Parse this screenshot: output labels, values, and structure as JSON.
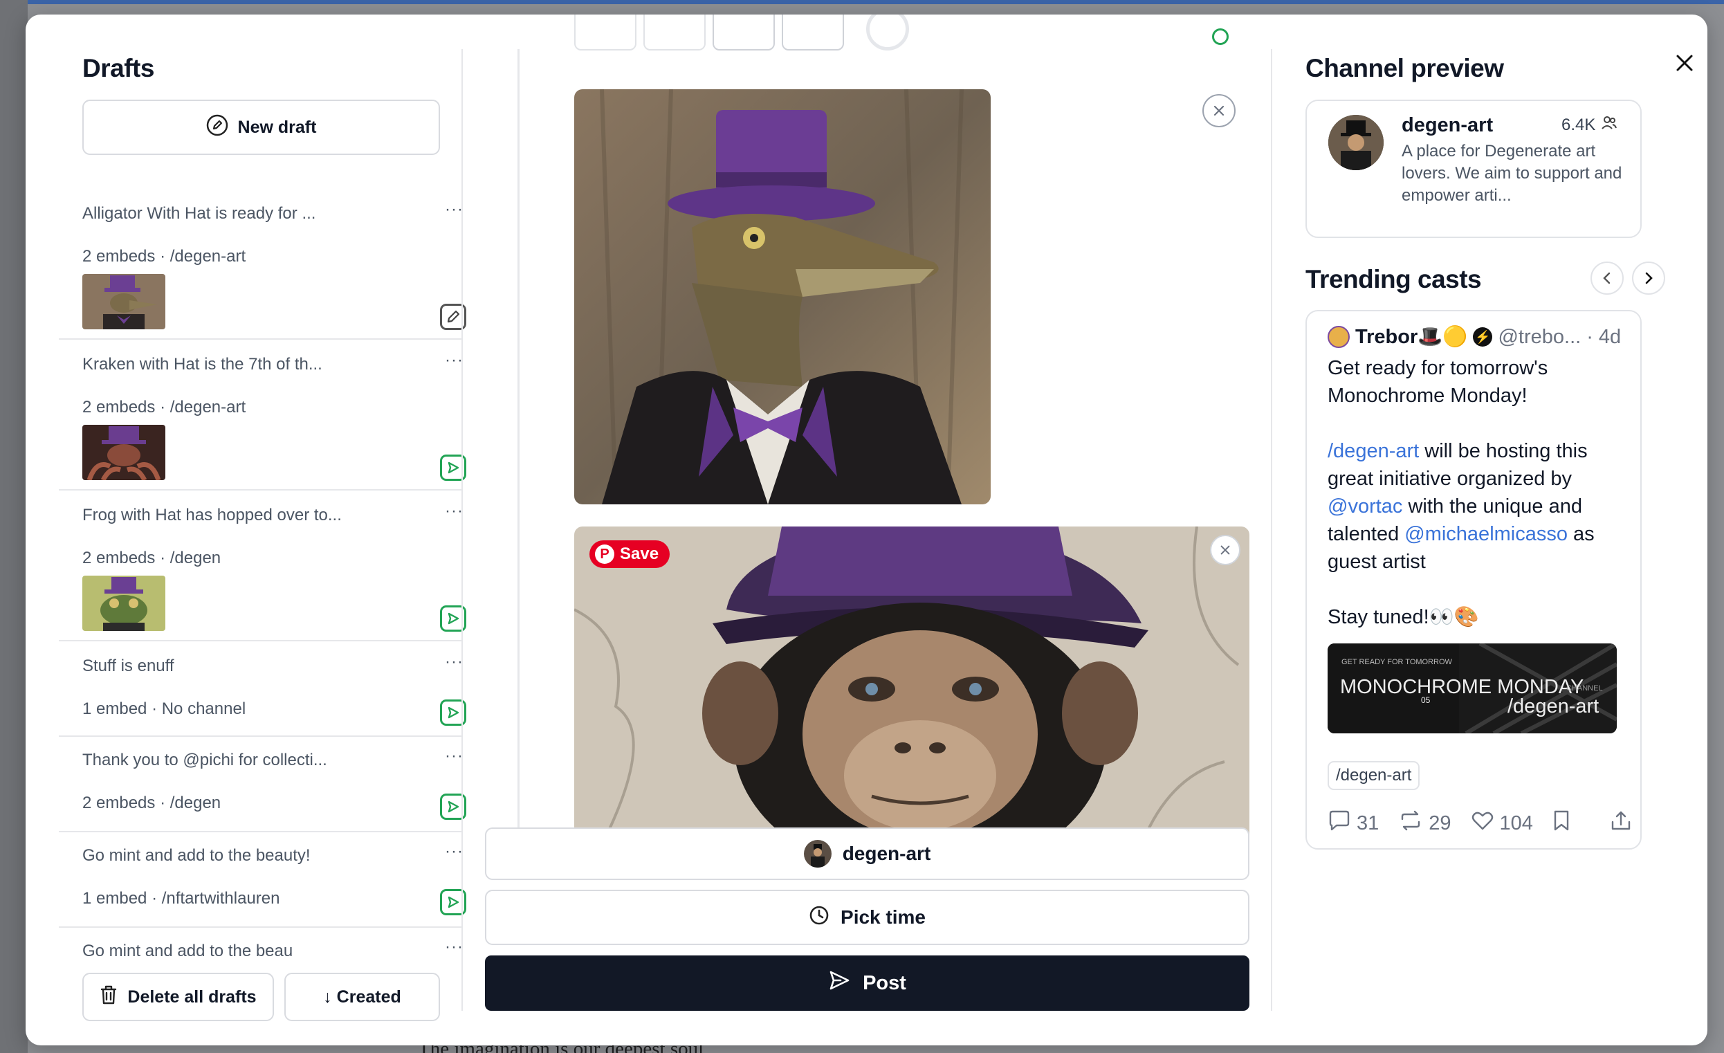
{
  "background": {
    "footer_text": "The imagination is our deepest soul"
  },
  "drafts": {
    "title": "Drafts",
    "new_draft_label": "New draft",
    "items": [
      {
        "title": "Alligator With Hat is ready for ...",
        "meta": "2 embeds · /degen-art",
        "thumb": "alligator",
        "action": "edit"
      },
      {
        "title": "Kraken with Hat is the 7th of th...",
        "meta": "2 embeds · /degen-art",
        "thumb": "kraken",
        "action": "send"
      },
      {
        "title": "Frog with Hat has hopped over to...",
        "meta": "2 embeds · /degen",
        "thumb": "frog",
        "action": "send"
      },
      {
        "title": "Stuff is enuff",
        "meta": "1 embed · No channel",
        "thumb": "",
        "action": "send"
      },
      {
        "title": "Thank you to @pichi for collecti...",
        "meta": "2 embeds · /degen",
        "thumb": "",
        "action": "send"
      },
      {
        "title": "Go mint and add to the beauty!",
        "meta": "1 embed · /nftartwithlauren",
        "thumb": "",
        "action": "send"
      },
      {
        "title": "Go mint and add to the beau",
        "meta": "",
        "thumb": "",
        "action": ""
      }
    ],
    "more_label": "···",
    "delete_all_label": "Delete all drafts",
    "sort_label": "↓ Created"
  },
  "composer": {
    "pin_save_label": "Save",
    "channel_label": "degen-art",
    "pick_time_label": "Pick time",
    "post_label": "Post"
  },
  "channel_preview": {
    "title": "Channel preview",
    "name": "degen-art",
    "member_count": "6.4K",
    "description": "A place for Degenerate art lovers. We aim to support and empower arti..."
  },
  "trending": {
    "title": "Trending casts",
    "cast": {
      "author": "Trebor🎩🟡",
      "handle": "@trebo...",
      "time": "· 4d",
      "line1": "Get ready for tomorrow's Monochrome Monday!",
      "channel_link": "/degen-art",
      "text2": " will be hosting this great initiative organized by ",
      "mention1": "@vortac",
      "text3": " with the unique and talented ",
      "mention2": "@michaelmicasso",
      "text4": " as guest artist",
      "line3": "Stay tuned!👀🎨",
      "image_top_text": "GET READY FOR TOMORROW",
      "image_title": "MONOCHROME MONDAY",
      "image_sup": "05",
      "image_channel_tag": "CHANNEL",
      "image_channel": "/degen-art",
      "tag": "/degen-art",
      "replies": "31",
      "recasts": "29",
      "likes": "104"
    }
  },
  "colors": {
    "accent_green": "#22a455",
    "post_bg": "#121826",
    "link": "#3a73d9",
    "pinterest": "#e60023"
  }
}
